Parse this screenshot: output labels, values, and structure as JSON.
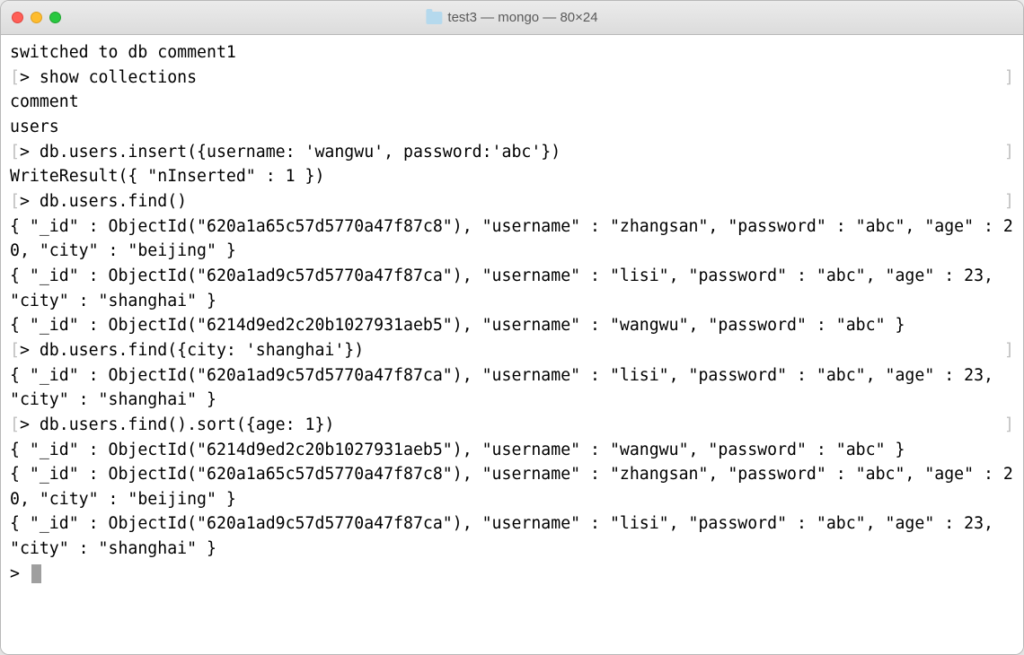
{
  "window": {
    "title": "test3 — mongo — 80×24"
  },
  "terminal": {
    "lines": [
      {
        "type": "plain",
        "text": "switched to db comment1"
      },
      {
        "type": "prompt",
        "text": "> show collections"
      },
      {
        "type": "plain",
        "text": "comment"
      },
      {
        "type": "plain",
        "text": "users"
      },
      {
        "type": "prompt",
        "text": "> db.users.insert({username: 'wangwu', password:'abc'})"
      },
      {
        "type": "plain",
        "text": "WriteResult({ \"nInserted\" : 1 })"
      },
      {
        "type": "prompt",
        "text": "> db.users.find()"
      },
      {
        "type": "plain",
        "text": "{ \"_id\" : ObjectId(\"620a1a65c57d5770a47f87c8\"), \"username\" : \"zhangsan\", \"password\" : \"abc\", \"age\" : 20, \"city\" : \"beijing\" }"
      },
      {
        "type": "plain",
        "text": "{ \"_id\" : ObjectId(\"620a1ad9c57d5770a47f87ca\"), \"username\" : \"lisi\", \"password\" : \"abc\", \"age\" : 23, \"city\" : \"shanghai\" }"
      },
      {
        "type": "plain",
        "text": "{ \"_id\" : ObjectId(\"6214d9ed2c20b1027931aeb5\"), \"username\" : \"wangwu\", \"password\" : \"abc\" }"
      },
      {
        "type": "prompt",
        "text": "> db.users.find({city: 'shanghai'})"
      },
      {
        "type": "plain",
        "text": "{ \"_id\" : ObjectId(\"620a1ad9c57d5770a47f87ca\"), \"username\" : \"lisi\", \"password\" : \"abc\", \"age\" : 23, \"city\" : \"shanghai\" }"
      },
      {
        "type": "prompt",
        "text": "> db.users.find().sort({age: 1})"
      },
      {
        "type": "plain",
        "text": "{ \"_id\" : ObjectId(\"6214d9ed2c20b1027931aeb5\"), \"username\" : \"wangwu\", \"password\" : \"abc\" }"
      },
      {
        "type": "plain",
        "text": "{ \"_id\" : ObjectId(\"620a1a65c57d5770a47f87c8\"), \"username\" : \"zhangsan\", \"password\" : \"abc\", \"age\" : 20, \"city\" : \"beijing\" }"
      },
      {
        "type": "plain",
        "text": "{ \"_id\" : ObjectId(\"620a1ad9c57d5770a47f87ca\"), \"username\" : \"lisi\", \"password\" : \"abc\", \"age\" : 23, \"city\" : \"shanghai\" }"
      }
    ],
    "final_prompt": "> "
  }
}
